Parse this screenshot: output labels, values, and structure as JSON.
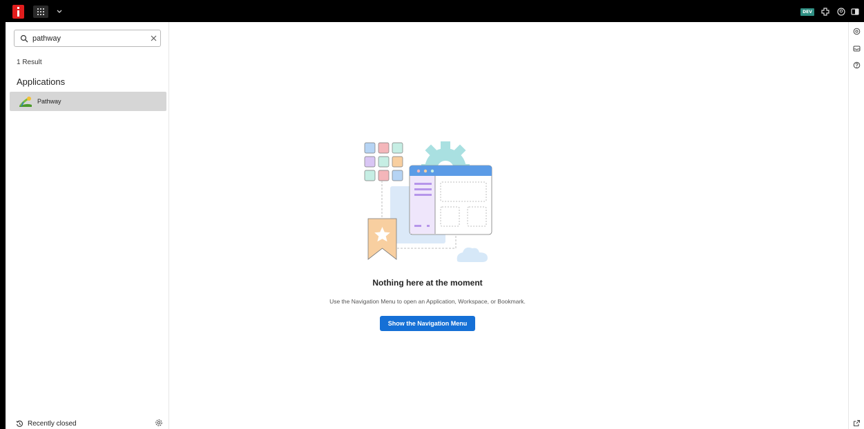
{
  "topbar": {
    "env_badge": "DEV",
    "icons": [
      "app-logo-icon",
      "app-grid-icon",
      "chevron-down-icon",
      "puzzle-icon",
      "user-circle-icon",
      "panel-toggle-icon"
    ]
  },
  "search": {
    "value": "pathway",
    "placeholder": ""
  },
  "results": {
    "count_label": "1 Result",
    "section_title": "Applications",
    "items": [
      {
        "label": "Pathway",
        "icon": "pathway-app-icon",
        "selected": true
      }
    ]
  },
  "footer": {
    "recently_closed_label": "Recently closed",
    "icons": [
      "history-icon",
      "settings-icon"
    ]
  },
  "main": {
    "empty_title": "Nothing here at the moment",
    "empty_description": "Use the Navigation Menu to open an Application, Workspace, or Bookmark.",
    "cta_label": "Show the Navigation Menu"
  },
  "rightrail": {
    "icons": [
      "gear-chat-icon",
      "inbox-icon",
      "help-icon",
      "external-link-icon"
    ]
  },
  "colors": {
    "topbar_bg": "#000000",
    "brand_red": "#e11d1d",
    "env_badge": "#2f8f83",
    "primary_button": "#1570d6",
    "selected_item_bg": "#d6d6d6"
  }
}
